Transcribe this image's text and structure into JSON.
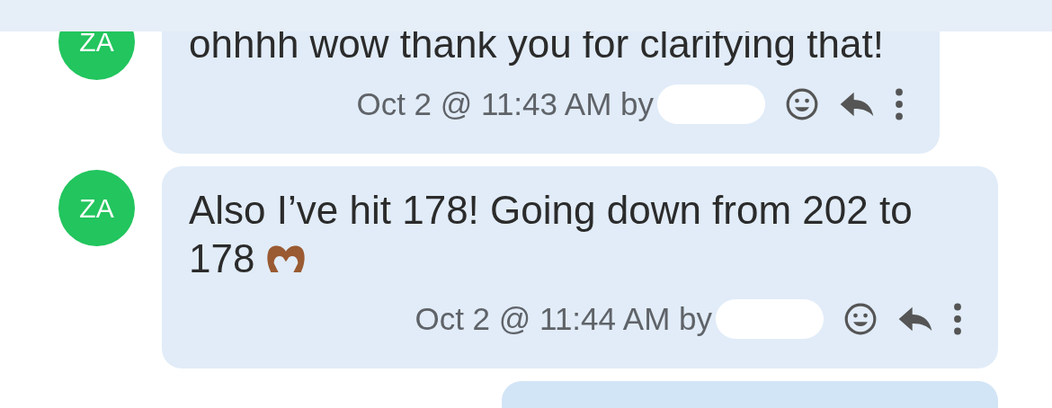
{
  "messages": [
    {
      "kind": "incoming",
      "avatar": "ZA",
      "text": "ohhhh wow thank you for clarifying that!",
      "meta": "Oct 2 @ 11:43 AM by",
      "redacted": true
    },
    {
      "kind": "incoming",
      "avatar": "ZA",
      "text": "Also I’ve hit 178! Going down from 202 to 178",
      "has_emoji": true,
      "meta": "Oct 2 @ 11:44 AM by",
      "redacted": true
    },
    {
      "kind": "outgoing"
    }
  ]
}
